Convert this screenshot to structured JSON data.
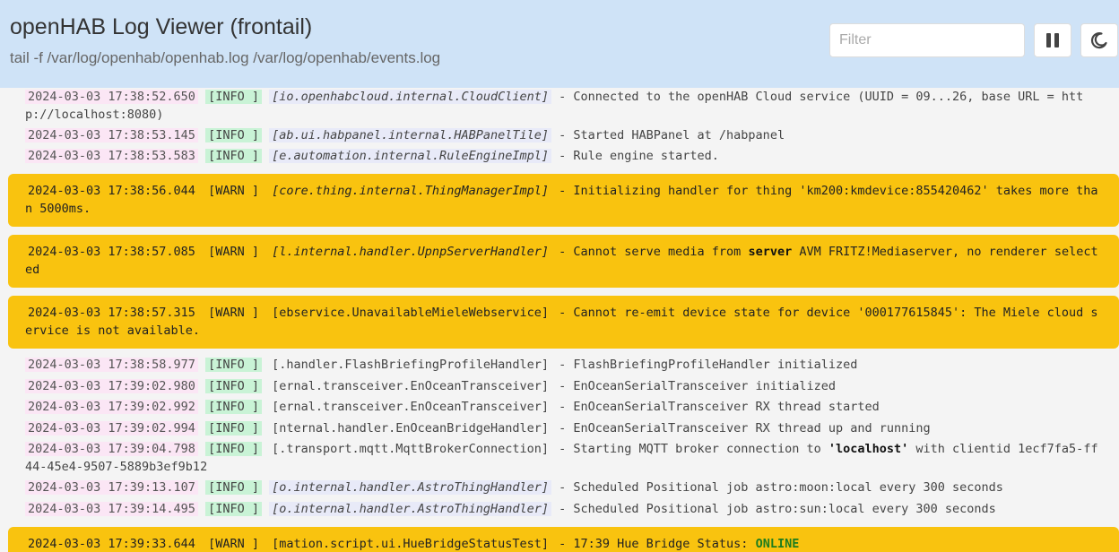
{
  "header": {
    "title": "openHAB Log Viewer (frontail)",
    "subtitle": "tail -f /var/log/openhab/openhab.log /var/log/openhab/events.log",
    "filter_placeholder": "Filter",
    "pause_icon": "pause-icon",
    "theme_icon": "moon-icon"
  },
  "colors": {
    "header_bg": "#cfe3f7",
    "warn_bg": "#f9c30f",
    "info_bg": "#c9f3d6",
    "date_bg": "#fbe6f5",
    "online": "#1e7d1e"
  },
  "log": [
    {
      "date": "2024-03-03 17:38:52.650",
      "level": "[INFO ]",
      "cls": "[io.openhabcloud.internal.CloudClient]",
      "msg": " - Connected to the openHAB Cloud service (UUID = 09...26, base URL = http://localhost:8080)"
    },
    {
      "date": "2024-03-03 17:38:53.145",
      "level": "[INFO ]",
      "cls": "[ab.ui.habpanel.internal.HABPanelTile]",
      "msg": " - Started HABPanel at /habpanel"
    },
    {
      "date": "2024-03-03 17:38:53.583",
      "level": "[INFO ]",
      "cls": "[e.automation.internal.RuleEngineImpl]",
      "msg": " - Rule engine started."
    },
    {
      "date": "2024-03-03 17:38:56.044",
      "level": "[WARN ]",
      "cls": "[core.thing.internal.ThingManagerImpl]",
      "msg": " - Initializing handler for thing 'km200:kmdevice:855420462' takes more than 5000ms."
    },
    {
      "date": "2024-03-03 17:38:57.085",
      "level": "[WARN ]",
      "cls": "[l.internal.handler.UpnpServerHandler]",
      "msg_a": " - Cannot serve media from ",
      "msg_kw": "server",
      "msg_b": " AVM FRITZ!Mediaserver, no renderer selected"
    },
    {
      "date": "2024-03-03 17:38:57.315",
      "level": "[WARN ]",
      "cls": "[ebservice.UnavailableMieleWebservice]",
      "msg": " - Cannot re-emit device state for device '000177615845': The Miele cloud service is not available."
    },
    {
      "date": "2024-03-03 17:38:58.977",
      "level": "[INFO ]",
      "cls": "[.handler.FlashBriefingProfileHandler]",
      "msg": " - FlashBriefingProfileHandler initialized"
    },
    {
      "date": "2024-03-03 17:39:02.980",
      "level": "[INFO ]",
      "cls": "[ernal.transceiver.EnOceanTransceiver]",
      "msg": " - EnOceanSerialTransceiver initialized"
    },
    {
      "date": "2024-03-03 17:39:02.992",
      "level": "[INFO ]",
      "cls": "[ernal.transceiver.EnOceanTransceiver]",
      "msg": " - EnOceanSerialTransceiver RX thread started"
    },
    {
      "date": "2024-03-03 17:39:02.994",
      "level": "[INFO ]",
      "cls": "[nternal.handler.EnOceanBridgeHandler]",
      "msg": " - EnOceanSerialTransceiver RX thread up and running"
    },
    {
      "date": "2024-03-03 17:39:04.798",
      "level": "[INFO ]",
      "cls": "[.transport.mqtt.MqttBrokerConnection]",
      "msg_a": " - Starting MQTT broker connection to ",
      "msg_kw": "'localhost'",
      "msg_b": " with clientid 1ecf7fa5-ff44-45e4-9507-5889b3ef9b12"
    },
    {
      "date": "2024-03-03 17:39:13.107",
      "level": "[INFO ]",
      "cls": "[o.internal.handler.AstroThingHandler]",
      "msg": " - Scheduled Positional job astro:moon:local every 300 seconds"
    },
    {
      "date": "2024-03-03 17:39:14.495",
      "level": "[INFO ]",
      "cls": "[o.internal.handler.AstroThingHandler]",
      "msg": " - Scheduled Positional job astro:sun:local every 300 seconds"
    },
    {
      "date": "2024-03-03 17:39:33.644",
      "level": "[WARN ]",
      "cls": "[mation.script.ui.HueBridgeStatusTest]",
      "msg_a": " - 17:39 Hue Bridge Status: ",
      "msg_kw": "ONLINE",
      "msg_b": ""
    }
  ]
}
